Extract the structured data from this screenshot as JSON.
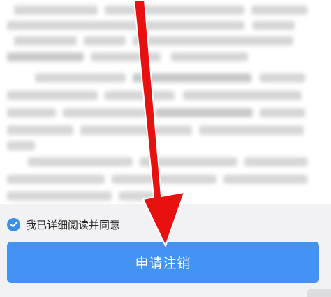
{
  "agreement": {
    "checked": true,
    "label": "我已详细阅读并同意"
  },
  "actions": {
    "apply_label": "申请注销"
  },
  "colors": {
    "accent": "#4293f3",
    "checkbox": "#3a8ee8",
    "annotation_arrow": "#e8110f"
  },
  "icons": {
    "check": "check-icon",
    "arrow": "down-arrow-annotation-icon"
  }
}
